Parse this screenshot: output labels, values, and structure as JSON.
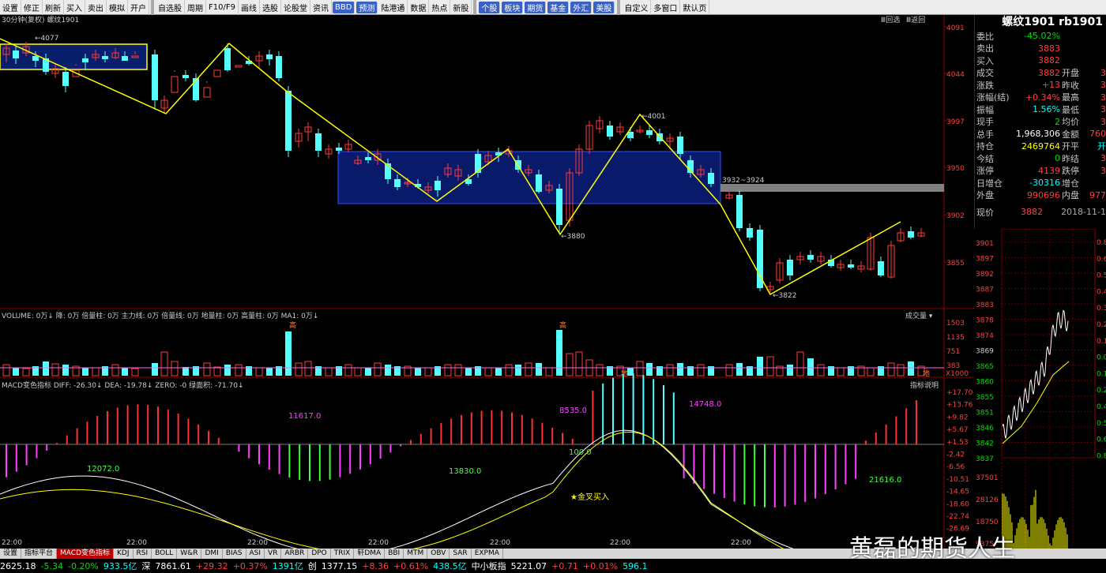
{
  "toolbar": {
    "items": [
      "设置",
      "修正",
      "刷新",
      "买入",
      "卖出",
      "模拟",
      "开户",
      "自选股",
      "周期",
      "F10/F9",
      "画线",
      "选股",
      "论股堂",
      "资讯",
      "BBD",
      "预测",
      "陆港通",
      "数据",
      "热点",
      "新股",
      "个股",
      "板块",
      "期货",
      "基金",
      "外汇",
      "美股",
      "自定义",
      "多窗口",
      "默认页"
    ],
    "highlight": [
      "BBD",
      "预测",
      "个股",
      "板块",
      "期货",
      "基金",
      "外汇",
      "美股"
    ]
  },
  "chart": {
    "header": "30分钟(复权)  螺纹1901",
    "right_btns": [
      "Ⅲ回选",
      "Ⅲ返回"
    ],
    "price_axis": [
      "4091",
      "4044",
      "3997",
      "3950",
      "3902",
      "3855"
    ],
    "annotations": {
      "hi": "4077",
      "a": "4001",
      "b": "3880",
      "c": "3822",
      "range": "3932~3924"
    },
    "time_labels": [
      "22:00",
      "22:00",
      "22:00",
      "22:00",
      "22:00",
      "22:00",
      "22:00"
    ]
  },
  "volume": {
    "header": "VOLUME: 0万↓  降: 0万  倍量柱: 0万  主力线: 0万  倍量线: 0万  地量柱: 0万  高量柱: 0万  MA1: 0万↓",
    "btn": "成交量",
    "axis": [
      "1503",
      "1135",
      "751",
      "383"
    ],
    "unit": "X1000",
    "tags": [
      "高",
      "高",
      "地",
      "地"
    ]
  },
  "macd": {
    "header": "MACD变色指标  DIFF: -26.30↓  DEA: -19.78↓  ZERO: -0  绿面积: -71.70↓",
    "btn": "指标说明",
    "axis": [
      "+17.70",
      "+13.76",
      "+9.82",
      "+5.67",
      "+1.53",
      "-2.42",
      "-6.56",
      "-10.51",
      "-14.65",
      "-18.60",
      "-22.74",
      "-26.69"
    ],
    "labels": [
      "11617.0",
      "8535.0",
      "14748.0",
      "12072.0",
      "13830.0",
      "100.0",
      "21616.0"
    ],
    "cross": "★金叉买入"
  },
  "quote": {
    "title": "螺纹1901 rb1901",
    "rows": [
      {
        "k": "委比",
        "v": "-45.02%",
        "c": "grn"
      },
      {
        "k": "卖出",
        "v": "3883",
        "c": "red"
      },
      {
        "k": "买入",
        "v": "3882",
        "c": "red"
      },
      {
        "k": "成交",
        "v": "3882",
        "c": "red",
        "k2": "开盘",
        "v2": "3"
      },
      {
        "k": "涨跌",
        "v": "+13",
        "c": "red",
        "k2": "昨收",
        "v2": "3"
      },
      {
        "k": "涨幅(结)",
        "v": "+0.34%",
        "c": "red",
        "k2": "最高",
        "v2": "3"
      },
      {
        "k": "振幅",
        "v": "1.56%",
        "c": "cyn",
        "k2": "最低",
        "v2": "3"
      },
      {
        "k": "现手",
        "v": "2",
        "c": "grn",
        "k2": "均价",
        "v2": "3"
      },
      {
        "k": "总手",
        "v": "1,968,306",
        "c": "wht",
        "k2": "金额",
        "v2": "760"
      },
      {
        "k": "持仓",
        "v": "2469764",
        "c": "yel",
        "k2": "开平",
        "v2": "开"
      },
      {
        "k": "今结",
        "v": "0",
        "c": "grn",
        "k2": "昨结",
        "v2": "3"
      },
      {
        "k": "涨停",
        "v": "4139",
        "c": "red",
        "k2": "跌停",
        "v2": "3"
      },
      {
        "k": "日增仓",
        "v": "-30316",
        "c": "cyn",
        "k2": "增仓",
        "v2": ""
      },
      {
        "k": "外盘",
        "v": "990696",
        "c": "red",
        "k2": "内盘",
        "v2": "977"
      }
    ],
    "now_label": "现价",
    "now_val": "3882",
    "date": "2018-11-1"
  },
  "mini": {
    "price_axis": [
      "3901",
      "3897",
      "3892",
      "3887",
      "3883",
      "3878",
      "3874",
      "3869",
      "3865",
      "3860",
      "3855",
      "3851",
      "3846",
      "3842",
      "3837"
    ],
    "vol_axis": [
      "37501",
      "28126",
      "18750",
      "9375"
    ],
    "pct_axis": [
      "0.8",
      "0.6",
      "0.5",
      "0.4",
      "0.3",
      "0.2",
      "0.1",
      "0.0",
      "0.1",
      "0.2",
      "0.4",
      "0.5",
      "0.6",
      "0.8"
    ]
  },
  "tabs": [
    "设置",
    "指标平台",
    "MACD变色指标",
    "KDJ",
    "RSI",
    "BOLL",
    "W&R",
    "DMI",
    "BIAS",
    "ASI",
    "VR",
    "ARBR",
    "DPO",
    "TRIX",
    "轩DMA",
    "BBI",
    "MTM",
    "OBV",
    "SAR",
    "EXPMA"
  ],
  "active_tab": "MACD变色指标",
  "status": [
    [
      "2625.18",
      "wht"
    ],
    [
      "-5.34",
      "grn"
    ],
    [
      "-0.20%",
      "grn"
    ],
    [
      "933.5亿",
      "cyn"
    ],
    [
      "深",
      "wht"
    ],
    [
      "7861.61",
      "wht"
    ],
    [
      "+29.32",
      "red"
    ],
    [
      "+0.37%",
      "red"
    ],
    [
      "1391亿",
      "cyn"
    ],
    [
      "创",
      "wht"
    ],
    [
      "1377.15",
      "wht"
    ],
    [
      "+8.36",
      "red"
    ],
    [
      "+0.61%",
      "red"
    ],
    [
      "438.5亿",
      "cyn"
    ],
    [
      "中小板指",
      "wht"
    ],
    [
      "5221.07",
      "wht"
    ],
    [
      "+0.71",
      "red"
    ],
    [
      "+0.01%",
      "red"
    ],
    [
      "596.1",
      "cyn"
    ]
  ],
  "watermark": "黄磊的期货人生",
  "colors": {
    "up": "#ff3b3b",
    "down": "#54ffff",
    "bg": "#000000",
    "frame": "#8b0000"
  }
}
